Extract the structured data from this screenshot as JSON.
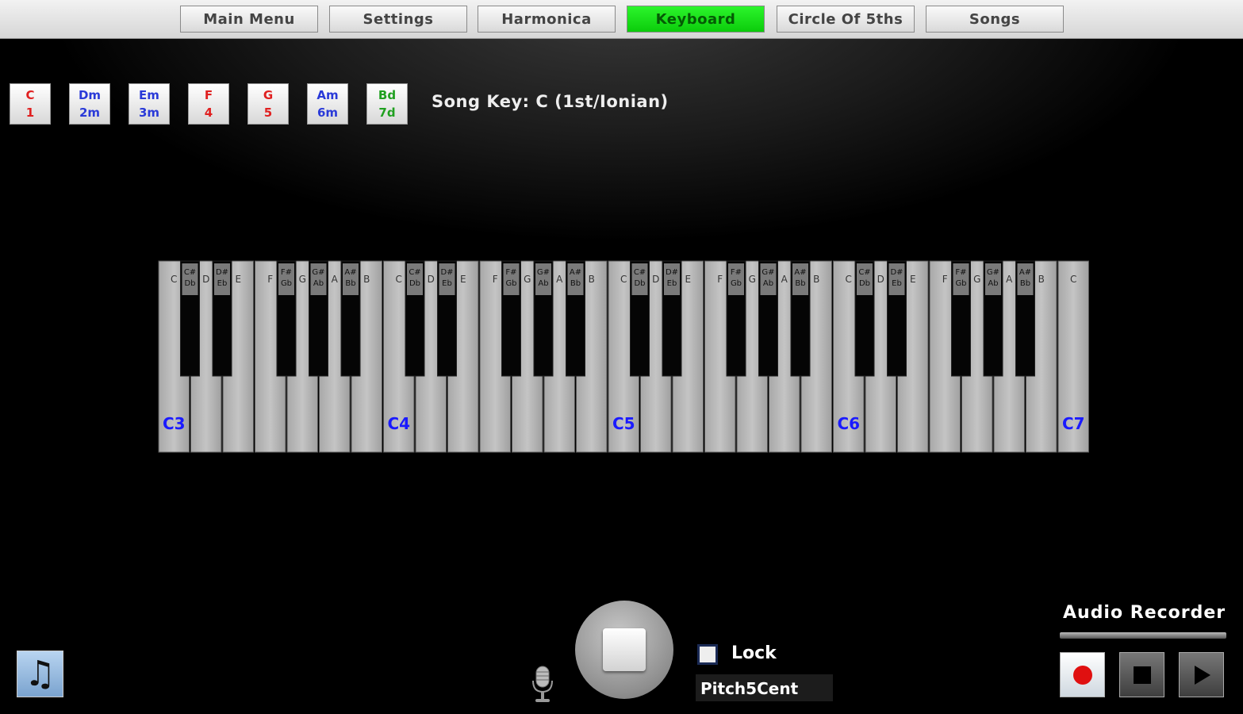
{
  "nav": [
    {
      "label": "Main Menu",
      "active": false
    },
    {
      "label": "Settings",
      "active": false
    },
    {
      "label": "Harmonica",
      "active": false
    },
    {
      "label": "Keyboard",
      "active": true
    },
    {
      "label": "Circle Of 5ths",
      "active": false
    },
    {
      "label": "Songs",
      "active": false
    }
  ],
  "chords": [
    {
      "name": "C",
      "degree": "1",
      "color": "#e02020"
    },
    {
      "name": "Dm",
      "degree": "2m",
      "color": "#2a3ad8"
    },
    {
      "name": "Em",
      "degree": "3m",
      "color": "#2a3ad8"
    },
    {
      "name": "F",
      "degree": "4",
      "color": "#e02020"
    },
    {
      "name": "G",
      "degree": "5",
      "color": "#e02020"
    },
    {
      "name": "Am",
      "degree": "6m",
      "color": "#2a3ad8"
    },
    {
      "name": "Bd",
      "degree": "7d",
      "color": "#20a020"
    }
  ],
  "song_key": "Song Key: C (1st/Ionian)",
  "keyboard": {
    "white_keys": [
      "C",
      "D",
      "E",
      "F",
      "G",
      "A",
      "B",
      "C",
      "D",
      "E",
      "F",
      "G",
      "A",
      "B",
      "C",
      "D",
      "E",
      "F",
      "G",
      "A",
      "B",
      "C",
      "D",
      "E",
      "F",
      "G",
      "A",
      "B",
      "C"
    ],
    "octave_labels": [
      "C3",
      "C4",
      "C5",
      "C6",
      "C7"
    ],
    "black_pattern": [
      [
        "C#",
        "Db"
      ],
      [
        "D#",
        "Eb"
      ],
      null,
      [
        "F#",
        "Gb"
      ],
      [
        "G#",
        "Ab"
      ],
      [
        "A#",
        "Bb"
      ],
      null
    ],
    "octave_label_color": "#1a1aff"
  },
  "controls": {
    "lock_label": "Lock",
    "lock_checked": false,
    "pitch_field": "Pitch5Cent",
    "music_icon": "♫"
  },
  "recorder": {
    "title": "Audio Recorder"
  }
}
